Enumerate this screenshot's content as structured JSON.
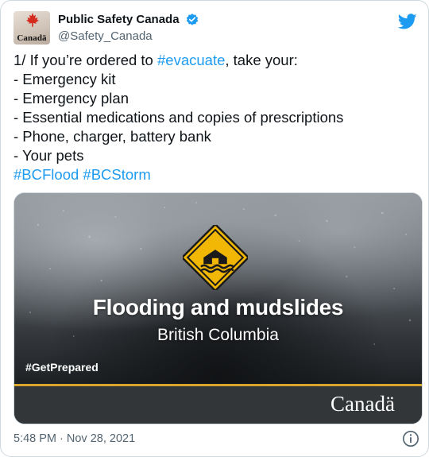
{
  "account": {
    "display_name": "Public Safety Canada",
    "handle": "@Safety_Canada",
    "avatar_wordmark": "Canadä"
  },
  "tweet": {
    "lines": [
      {
        "prefix": "1/ If you’re ordered to ",
        "hashtag": "#evacuate",
        "suffix": ", take your:"
      },
      {
        "text": "- Emergency kit"
      },
      {
        "text": "- Emergency plan"
      },
      {
        "text": "- Essential medications and copies of prescriptions"
      },
      {
        "text": "- Phone, charger, battery bank"
      },
      {
        "text": "- Your pets"
      }
    ],
    "hashtags": [
      "#BCFlood",
      "#BCStorm"
    ]
  },
  "media": {
    "headline": "Flooding and mudslides",
    "subline": "British Columbia",
    "tag": "#GetPrepared",
    "wordmark": "Canadä"
  },
  "meta": {
    "timestamp": "5:48 PM · Nov 28, 2021"
  },
  "colors": {
    "accent": "#1d9bf0",
    "warning_yellow": "#f2b705",
    "gold_rule": "#d7a52b",
    "maple_red": "#d52b1e"
  },
  "icons": [
    "maple-leaf-icon",
    "verified-badge-icon",
    "twitter-bird-icon",
    "flood-warning-icon",
    "info-icon"
  ]
}
